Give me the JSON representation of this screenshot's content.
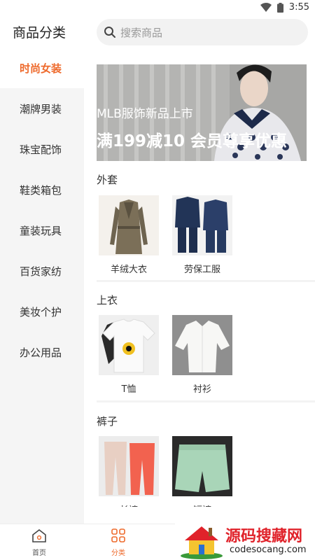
{
  "status": {
    "time": "3:55"
  },
  "header": {
    "title": "商品分类",
    "search_placeholder": "搜索商品"
  },
  "sidebar": {
    "items": [
      {
        "label": "时尚女装",
        "active": true
      },
      {
        "label": "潮牌男装"
      },
      {
        "label": "珠宝配饰"
      },
      {
        "label": "鞋类箱包"
      },
      {
        "label": "童装玩具"
      },
      {
        "label": "百货家纺"
      },
      {
        "label": "美妆个护"
      },
      {
        "label": "办公用品"
      }
    ]
  },
  "banner": {
    "line1": "MLB服饰新品上市",
    "line2": "满199减10 会员尊享优惠"
  },
  "sections": [
    {
      "title": "外套",
      "items": [
        {
          "label": "羊绒大衣"
        },
        {
          "label": "劳保工服"
        }
      ]
    },
    {
      "title": "上衣",
      "items": [
        {
          "label": "T恤"
        },
        {
          "label": "衬衫"
        }
      ]
    },
    {
      "title": "裤子",
      "items": [
        {
          "label": "长裤"
        },
        {
          "label": "短裤"
        }
      ]
    }
  ],
  "tabbar": {
    "tabs": [
      {
        "label": "首页"
      },
      {
        "label": "分类",
        "active": true
      }
    ]
  },
  "watermark": {
    "title": "源码搜藏网",
    "url": "codesocang.com"
  },
  "colors": {
    "accent": "#ee6a2c",
    "sidebar_bg": "#f5f5f5",
    "watermark_red": "#e0222a"
  }
}
